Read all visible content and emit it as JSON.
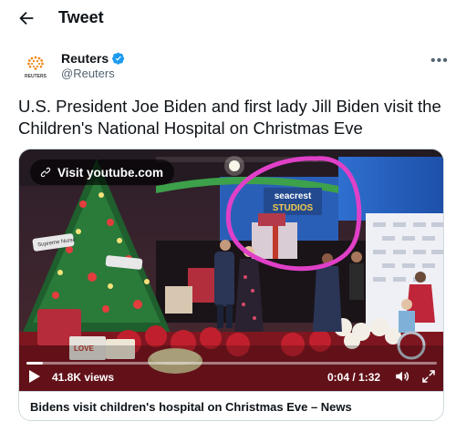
{
  "header": {
    "title": "Tweet"
  },
  "author": {
    "avatar_label": "REUTERS",
    "name": "Reuters",
    "handle": "@Reuters",
    "verified": true
  },
  "tweet": {
    "text": "U.S. President Joe Biden and first lady Jill Biden visit the Children's National Hospital on Christmas Eve"
  },
  "video": {
    "visit_label": "Visit youtube.com",
    "views": "41.8K views",
    "time": "0:04 / 1:32",
    "progress": 0.04,
    "backdrop_text_1": "seacrest",
    "backdrop_text_2": "STUDIOS",
    "sign_text": "Supreme Nurse",
    "present_text": "LOVE"
  },
  "card": {
    "title": "Bidens visit children's hospital on Christmas Eve – News"
  },
  "colors": {
    "accent": "#1d9bf0",
    "annotation_circle": "#e040c8",
    "text_secondary": "#536471"
  },
  "icons": [
    "back-arrow-icon",
    "verified-icon",
    "more-icon",
    "link-icon",
    "play-icon",
    "volume-icon",
    "fullscreen-icon"
  ]
}
